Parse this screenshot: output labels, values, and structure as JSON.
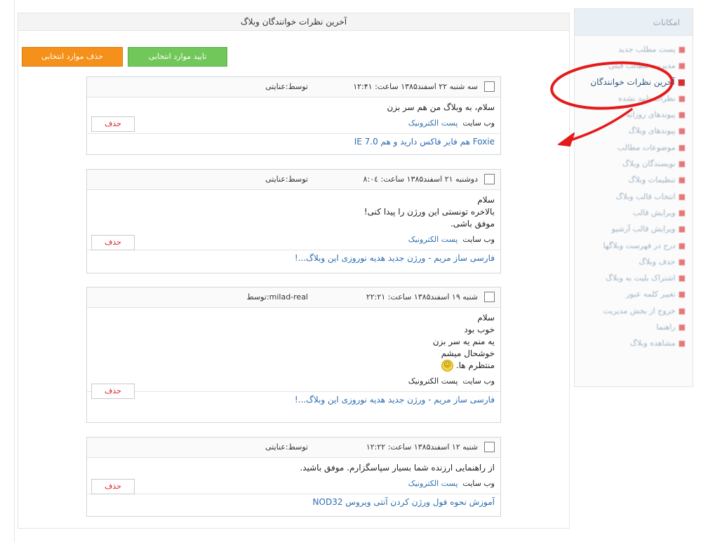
{
  "sidebar": {
    "header": "امکانات",
    "items": [
      {
        "label": "پست مطلب جدید"
      },
      {
        "label": "مدیریت مطالب قبلی"
      },
      {
        "label": "آخرین نظرات خوانندگان",
        "active": true
      },
      {
        "label": "نظرات تایید نشده"
      },
      {
        "label": "پیوندهای روزانه"
      },
      {
        "label": "پیوندهای وبلاگ"
      },
      {
        "label": "موضوعات مطالب"
      },
      {
        "label": "نویسندگان وبلاگ"
      },
      {
        "label": "تنظیمات وبلاگ"
      },
      {
        "label": "انتخاب قالب وبلاگ"
      },
      {
        "label": "ویرایش قالب"
      },
      {
        "label": "ویرایش قالب آرشیو"
      },
      {
        "label": "درج در فهرست وبلاگها"
      },
      {
        "label": "حذف وبلاگ"
      },
      {
        "label": "اشتراک بلیت به وبلاگ"
      },
      {
        "label": "تغییر کلمه عبور"
      },
      {
        "label": "خروج از بخش مدیریت"
      },
      {
        "label": "راهنما"
      },
      {
        "label": "مشاهده وبلاگ"
      }
    ]
  },
  "main": {
    "title": "آخرین نظرات خوانندگان وبلاگ",
    "approve_label": "تایید موارد انتخابی",
    "delete_selected_label": "حذف موارد انتخابی",
    "delete_label": "حذف",
    "website_label": "وب سایت",
    "email_label": "پست الکترونیک",
    "comments": [
      {
        "date": "سه شنبه ۲۲ اسفند۱۳۸۵ ساعت: ۱۲:۴۱",
        "author": "توسط:عنایتی",
        "lines": [
          "سلام، به وبلاگ من هم سر بزن"
        ],
        "post": "Foxie هم فایر فاکس دارید و هم IE 7.0"
      },
      {
        "date": "دوشنبه ۲۱ اسفند۱۳۸۵ ساعت: ۸:۰٤",
        "author": "توسط:عنایتی",
        "lines": [
          "سلام",
          "بالاخره تونستی این ورژن را پیدا کنی!",
          "موفق باشی."
        ],
        "post": "فارسی ساز مریم - ورژن جدید هدیه نوروزی این وبلاگ...!"
      },
      {
        "date": "شنبه ۱۹ اسفند۱۳۸۵ ساعت: ۲۲:۲۱",
        "author": "milad-real:توسط",
        "lines": [
          "سلام",
          "خوب بود",
          "یه منم یه سر بزن",
          "خوشحال میشم",
          "منتظرم ها."
        ],
        "post": "فارسی ساز مریم - ورژن جدید هدیه نوروزی این وبلاگ...!"
      },
      {
        "date": "شنبه ۱۲ اسفند۱۳۸۵ ساعت: ۱۲:۲۲",
        "author": "توسط:عنایتی",
        "lines": [
          "از راهنمایی ارزنده شما بسیار سپاسگزارم. موفق باشید."
        ],
        "post": "آموزش نحوه فول ورژن کردن آنتی ویروس NOD32"
      }
    ]
  },
  "colors": {
    "approve": "#72c75a",
    "delete_selected": "#f5901a",
    "annotation": "#e41b1b",
    "link": "#2b6cb0"
  }
}
